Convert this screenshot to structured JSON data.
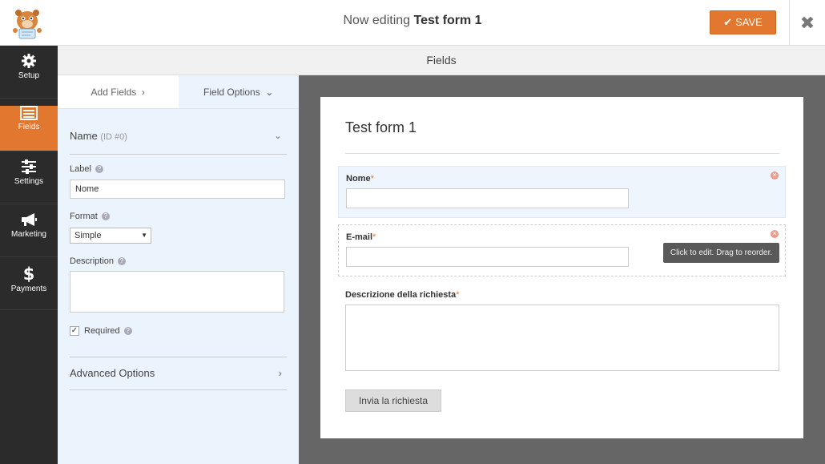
{
  "header": {
    "editing_prefix": "Now editing",
    "form_name": "Test form 1",
    "save_label": "SAVE",
    "close_glyph": "✖"
  },
  "nav": {
    "items": [
      {
        "label": "Setup",
        "icon": "gear-icon"
      },
      {
        "label": "Fields",
        "icon": "list-icon",
        "active": true
      },
      {
        "label": "Settings",
        "icon": "sliders-icon"
      },
      {
        "label": "Marketing",
        "icon": "megaphone-icon"
      },
      {
        "label": "Payments",
        "icon": "dollar-icon"
      }
    ]
  },
  "fields_header": "Fields",
  "panel": {
    "tabs": {
      "add": "Add Fields",
      "options": "Field Options"
    },
    "field_name": "Name",
    "field_id": "(ID #0)",
    "label_label": "Label",
    "label_value": "Nome",
    "format_label": "Format",
    "format_value": "Simple",
    "description_label": "Description",
    "required_label": "Required",
    "advanced_label": "Advanced Options"
  },
  "preview": {
    "title": "Test form 1",
    "fields": [
      {
        "label": "Nome",
        "required": "*"
      },
      {
        "label": "E-mail",
        "required": "*"
      },
      {
        "label": "Descrizione della richiesta",
        "required": "*"
      }
    ],
    "tooltip": "Click to edit. Drag to reorder.",
    "submit_label": "Invia la richiesta"
  },
  "colors": {
    "accent": "#e27730",
    "nav_bg": "#2b2b2b",
    "panel_bg": "#ebf3fc",
    "preview_bg": "#666666"
  }
}
